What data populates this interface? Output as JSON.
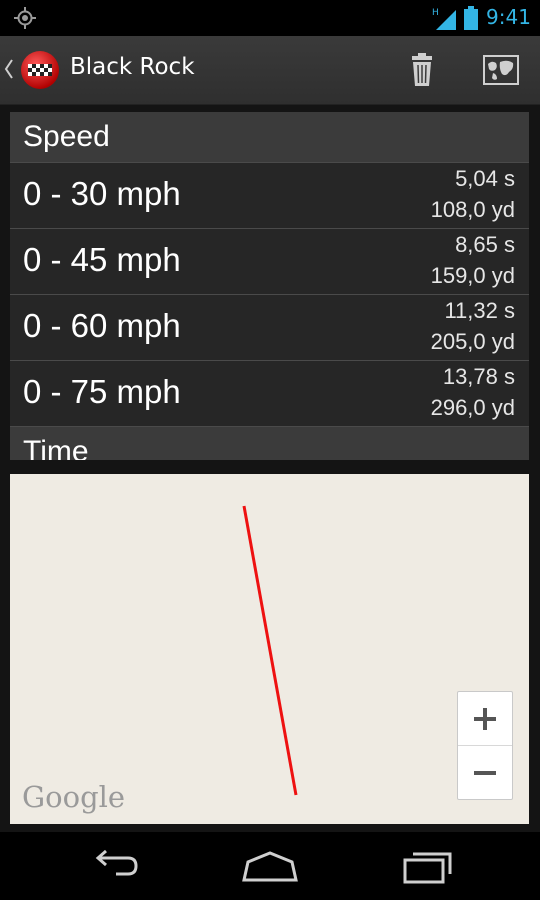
{
  "status_bar": {
    "time": "9:41",
    "network_label": "H",
    "accent_color": "#33b5e5"
  },
  "action_bar": {
    "title": "Black Rock",
    "app_icon": "checkered-flag-icon",
    "actions": [
      "trash-icon",
      "map-icon"
    ]
  },
  "stats": {
    "speed_header": "Speed",
    "rows": [
      {
        "label": "0 - 30 mph",
        "time": "5,04 s",
        "distance": "108,0 yd"
      },
      {
        "label": "0 - 45 mph",
        "time": "8,65 s",
        "distance": "159,0 yd"
      },
      {
        "label": "0 - 60 mph",
        "time": "11,32 s",
        "distance": "205,0 yd"
      },
      {
        "label": "0 - 75 mph",
        "time": "13,78 s",
        "distance": "296,0 yd"
      }
    ],
    "next_header": "Time"
  },
  "map": {
    "attribution": "Google",
    "zoom_in": "+",
    "zoom_out": "−",
    "route_color": "#ee1111",
    "background_color": "#efebe3"
  },
  "nav_bar": {
    "buttons": [
      "back-icon",
      "home-icon",
      "recents-icon"
    ]
  }
}
